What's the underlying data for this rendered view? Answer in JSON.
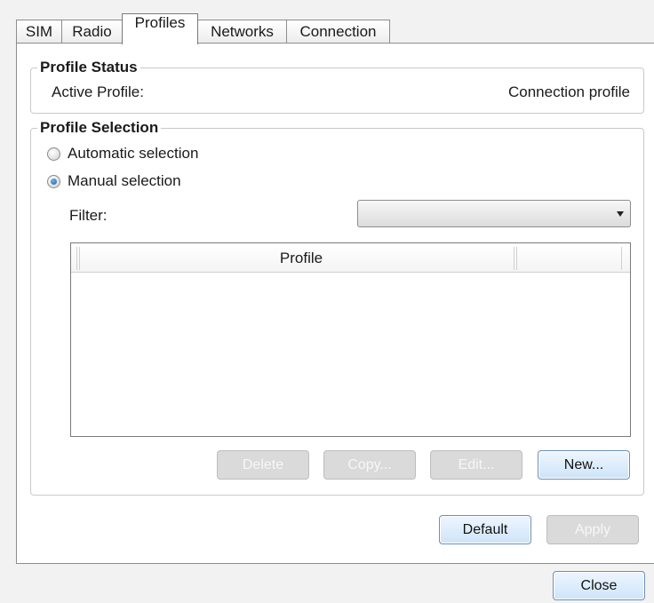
{
  "tabs": [
    {
      "label": "SIM"
    },
    {
      "label": "Radio"
    },
    {
      "label": "Profiles"
    },
    {
      "label": "Networks"
    },
    {
      "label": "Connection"
    }
  ],
  "active_tab": "Profiles",
  "profile_status": {
    "title": "Profile Status",
    "active_profile_label": "Active Profile:",
    "active_profile_value": "Connection profile"
  },
  "profile_selection": {
    "title": "Profile Selection",
    "automatic_label": "Automatic selection",
    "manual_label": "Manual selection",
    "selected_mode": "manual",
    "filter_label": "Filter:",
    "filter_value": "",
    "table": {
      "columns": [
        "Profile"
      ],
      "rows": []
    },
    "buttons": {
      "delete": "Delete",
      "copy": "Copy...",
      "edit": "Edit...",
      "new": "New..."
    }
  },
  "footer_buttons": {
    "default": "Default",
    "apply": "Apply",
    "close": "Close"
  },
  "colors": {
    "window_bg": "#f2f2f2",
    "panel_bg": "#ffffff",
    "button_blue": "#cfe4f8",
    "disabled_button": "#dadada"
  }
}
